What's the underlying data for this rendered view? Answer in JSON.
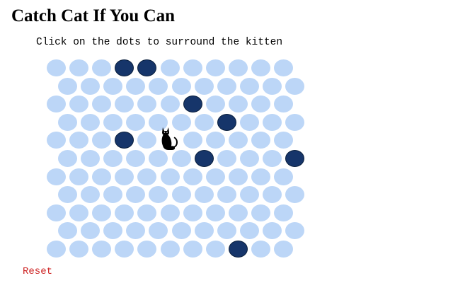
{
  "game": {
    "title": "Catch Cat If You Can",
    "instructions": "Click on the dots to surround the kitten",
    "reset_label": "Reset"
  },
  "colors": {
    "empty_dot": "#bcd6f7",
    "wall_dot": "#16356a",
    "cat_cell": "#ffffff",
    "cat": "#000000",
    "reset_text": "#cc1f1f"
  },
  "board": {
    "rows": 11,
    "cols": 11,
    "cat": {
      "row": 4,
      "col": 5
    },
    "walls": [
      {
        "row": 0,
        "col": 3
      },
      {
        "row": 0,
        "col": 4
      },
      {
        "row": 2,
        "col": 6
      },
      {
        "row": 3,
        "col": 7
      },
      {
        "row": 4,
        "col": 3
      },
      {
        "row": 5,
        "col": 6
      },
      {
        "row": 5,
        "col": 10
      },
      {
        "row": 10,
        "col": 8
      }
    ]
  },
  "icons": {
    "cat": "cat-icon"
  }
}
